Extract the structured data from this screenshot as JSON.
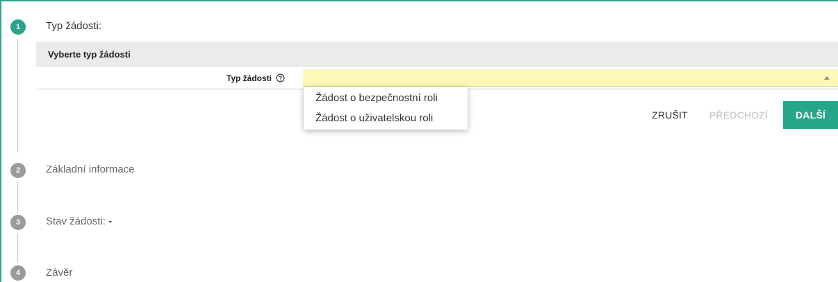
{
  "steps": [
    {
      "number": "1",
      "title": "Typ žádosti:",
      "active": true
    },
    {
      "number": "2",
      "title": "Základní informace",
      "active": false
    },
    {
      "number": "3",
      "title": "Stav žádosti:",
      "value": "-",
      "active": false
    },
    {
      "number": "4",
      "title": "Závěr",
      "active": false
    }
  ],
  "section": {
    "header": "Vyberte typ žádosti",
    "field_label": "Typ žádosti",
    "field_value": ""
  },
  "dropdown": {
    "options": [
      "Žádost o bezpečnostní roli",
      "Žádost o uživatelskou roli"
    ]
  },
  "buttons": {
    "cancel": "ZRUŠIT",
    "previous": "PŘEDCHOZÍ",
    "next": "DALŠÍ"
  },
  "colors": {
    "accent": "#26a58a",
    "select_background": "#fff9b8",
    "inactive_step": "#9a9a9a"
  },
  "icons": {
    "help": "help-circle-icon",
    "dropdown_caret": "caret-up-icon"
  }
}
